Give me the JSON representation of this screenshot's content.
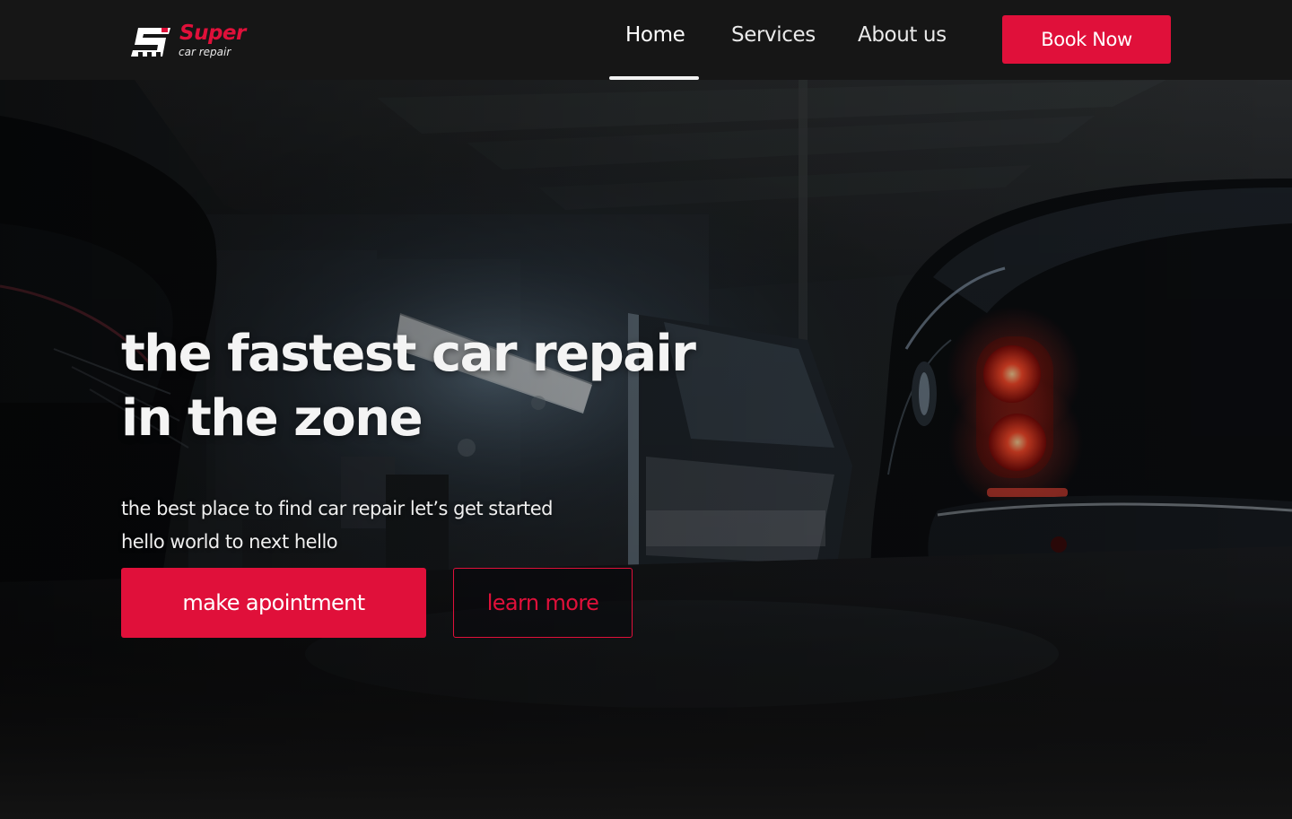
{
  "brand": {
    "name": "Super",
    "tagline": "car repair",
    "accent_color": "#e0103a",
    "logo_icon": "checkered-s-logo-icon"
  },
  "nav": {
    "items": [
      {
        "label": "Home",
        "active": true
      },
      {
        "label": "Services",
        "active": false
      },
      {
        "label": "About us",
        "active": false
      }
    ],
    "book_label": "Book Now"
  },
  "hero": {
    "headline_line1": "the fastest car repair",
    "headline_line2": "in the zone",
    "subtitle_line1": "the best place to find car repair let’s get started",
    "subtitle_line2": "hello world to next hello",
    "primary_cta": "make apointment",
    "secondary_cta": "learn more",
    "background_image": "dark-garage-car-photo"
  }
}
